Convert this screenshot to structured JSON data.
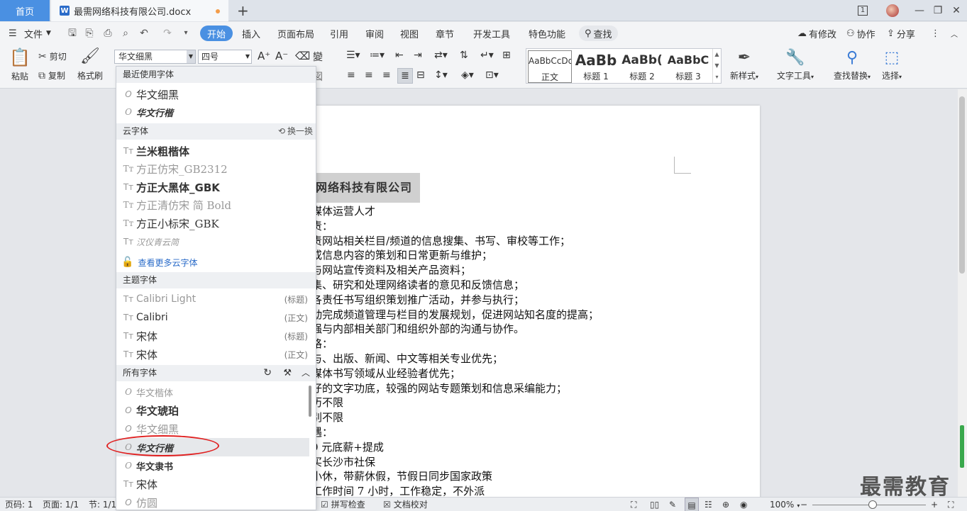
{
  "tabs": {
    "home": "首页",
    "doc_title": "最需网络科技有限公司.docx",
    "add": "+"
  },
  "window": {
    "minimize": "—",
    "restore": "❐",
    "close": "✕",
    "page_indicator": "1"
  },
  "menu": {
    "file": "文件",
    "items": [
      "开始",
      "插入",
      "页面布局",
      "引用",
      "审阅",
      "视图",
      "章节",
      "开发工具",
      "特色功能"
    ],
    "search": "查找",
    "right": [
      "有修改",
      "协作",
      "分享"
    ]
  },
  "ribbon": {
    "paste": "粘贴",
    "cut": "剪切",
    "copy": "复制",
    "format_painter": "格式刷",
    "font_name": "华文细黑",
    "font_size": "四号",
    "styles": [
      {
        "preview": "AaBbCcDd",
        "label": "正文"
      },
      {
        "preview": "AaBb",
        "label": "标题 1"
      },
      {
        "preview": "AaBb(",
        "label": "标题 2"
      },
      {
        "preview": "AaBbC",
        "label": "标题 3"
      }
    ],
    "new_style": "新样式",
    "text_tools": "文字工具",
    "find_replace": "查找替换",
    "select": "选择"
  },
  "font_panel": {
    "recent_header": "最近使用字体",
    "recent": [
      "华文细黑",
      "华文行楷"
    ],
    "cloud_header": "云字体",
    "cloud_switch": "换一换",
    "cloud": [
      "兰米粗楷体",
      "方正仿宋_GB2312",
      "方正大黑体_GBK",
      "方正清仿宋 简 Bold",
      "方正小标宋_GBK",
      "汉仪青云简"
    ],
    "more_cloud": "查看更多云字体",
    "theme_header": "主题字体",
    "theme": [
      {
        "name": "Calibri Light",
        "tag": "(标题)"
      },
      {
        "name": "Calibri",
        "tag": "(正文)"
      },
      {
        "name": "宋体",
        "tag": "(标题)"
      },
      {
        "name": "宋体",
        "tag": "(正文)"
      }
    ],
    "all_header": "所有字体",
    "all": [
      "华文楷体",
      "华文琥珀",
      "华文细黑",
      "华文行楷",
      "华文隶书",
      "宋体",
      "仿圆"
    ]
  },
  "document": {
    "title": "网络科技有限公司",
    "lines": [
      "媒体运营人才",
      "责：",
      "责网站相关栏目/频道的信息搜集、书写、审校等工作；",
      "或信息内容的策划和日常更新与维护；",
      "与网站宣传资料及相关产品资料；",
      "集、研究和处理网络读者的意见和反馈信息；",
      "各责任书写组织策划推广活动，并参与执行；",
      "动完成频道管理与栏目的发展规划，促进网站知名度的提高；",
      "强与内部相关部门和组织外部的沟通与协作。",
      "格：",
      "与、出版、新闻、中文等相关专业优先；",
      "媒体书写领域从业经验者优先；",
      "仔的文字功底，较强的网站专题策划和信息采编能力；",
      "历不限",
      "别不限",
      "遇：",
      "0 元底薪+提成",
      "买长沙市社保",
      "小休，带薪休假，节假日同步国家政策",
      "工作时间 7 小时，工作稳定，不外派"
    ]
  },
  "watermark": "最需教育",
  "status": {
    "page": "页码: 1",
    "pages": "页面: 1/1",
    "section": "节: 1/1",
    "spell": "拼写检查",
    "proof": "文档校对",
    "zoom": "100%"
  }
}
